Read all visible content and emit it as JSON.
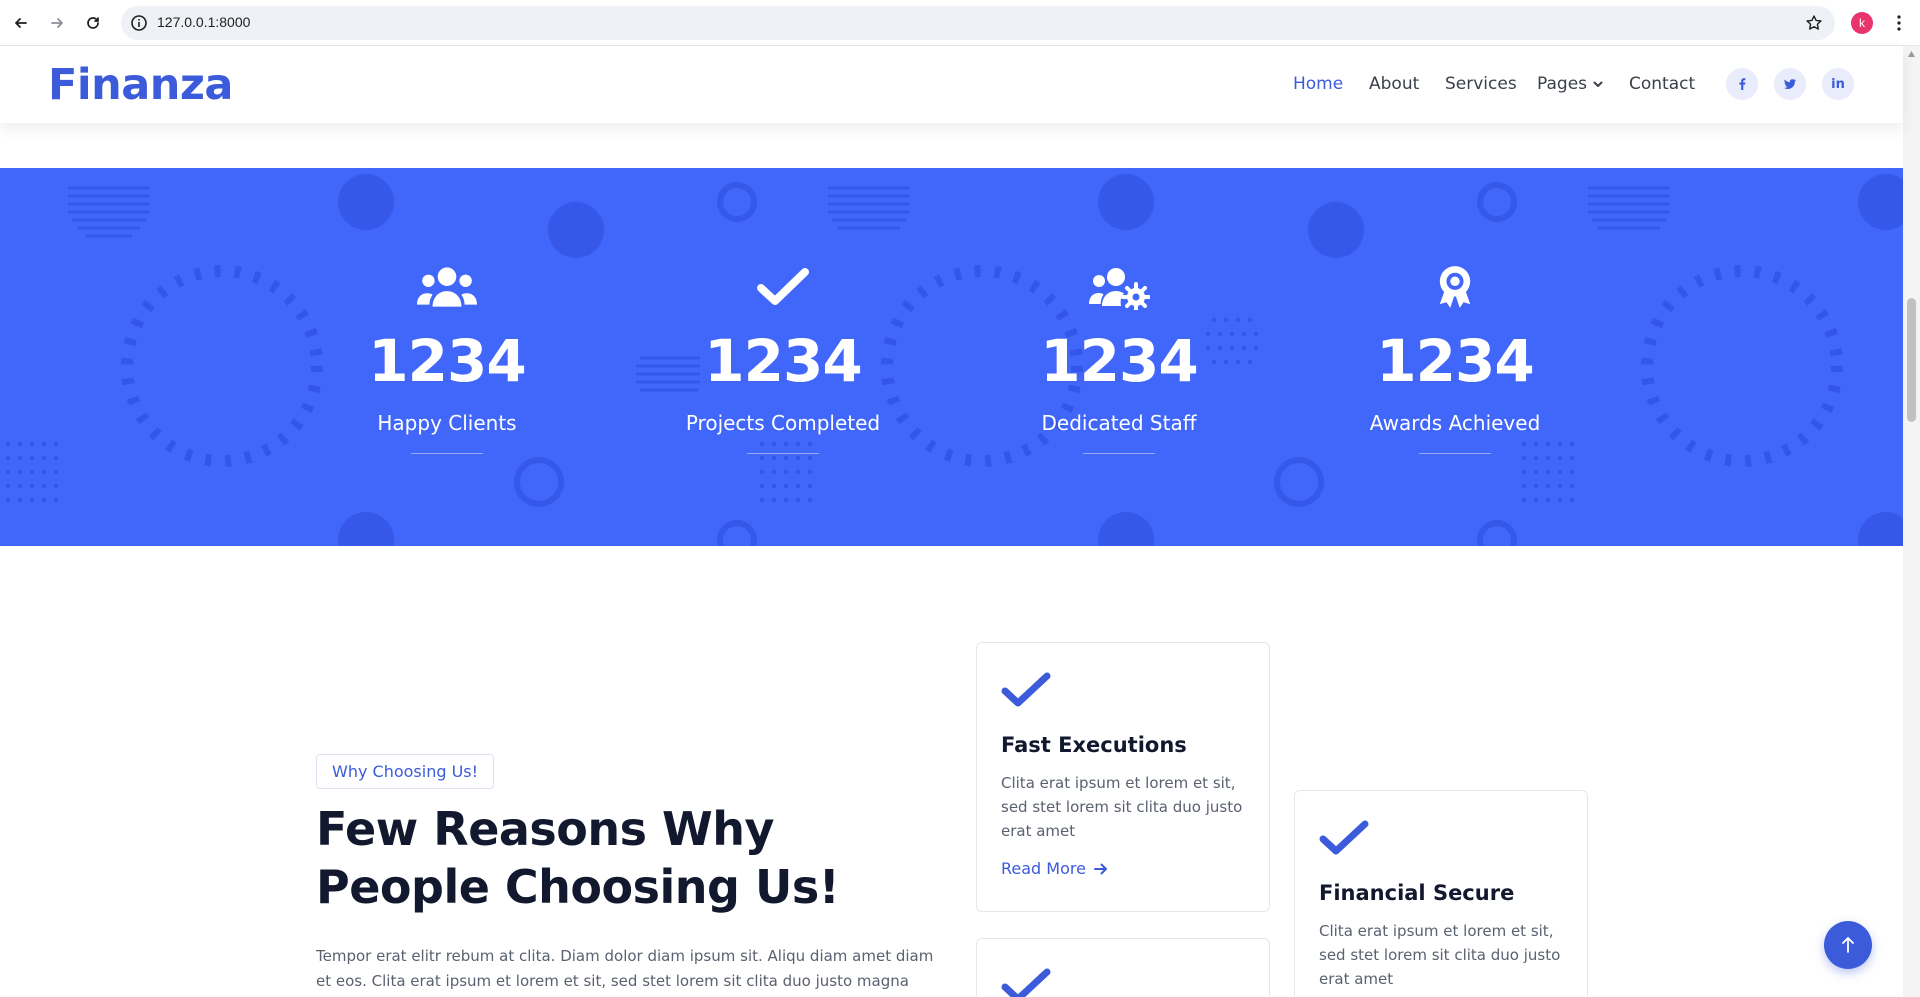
{
  "browser": {
    "url": "127.0.0.1:8000",
    "profile_initial": "k"
  },
  "header": {
    "logo": "Finanza",
    "nav": [
      {
        "label": "Home",
        "active": true
      },
      {
        "label": "About",
        "active": false
      },
      {
        "label": "Services",
        "active": false
      },
      {
        "label": "Pages",
        "active": false,
        "dropdown": true
      },
      {
        "label": "Contact",
        "active": false
      }
    ],
    "social": [
      "facebook-icon",
      "twitter-icon",
      "linkedin-icon"
    ],
    "social_linkedin_text": "in"
  },
  "stats": [
    {
      "icon": "users-icon",
      "value": "1234",
      "label": "Happy Clients"
    },
    {
      "icon": "check-icon",
      "value": "1234",
      "label": "Projects Completed"
    },
    {
      "icon": "users-gear-icon",
      "value": "1234",
      "label": "Dedicated Staff"
    },
    {
      "icon": "award-icon",
      "value": "1234",
      "label": "Awards Achieved"
    }
  ],
  "why": {
    "badge": "Why Choosing Us!",
    "heading": "Few Reasons Why People Choosing Us!",
    "paragraph": "Tempor erat elitr rebum at clita. Diam dolor diam ipsum sit. Aliqu diam amet diam et eos. Clita erat ipsum et lorem et sit, sed stet lorem sit clita duo justo magna dolore erat amet"
  },
  "cards": [
    {
      "title": "Fast Executions",
      "text": "Clita erat ipsum et lorem et sit, sed stet lorem sit clita duo justo erat amet",
      "link": "Read More"
    },
    {
      "title": "Financial Secure",
      "text": "Clita erat ipsum et lorem et sit, sed stet lorem sit clita duo justo erat amet"
    }
  ],
  "colors": {
    "brand": "#3b5bdb",
    "stats_bg": "#4066fa",
    "heading": "#12192e"
  }
}
